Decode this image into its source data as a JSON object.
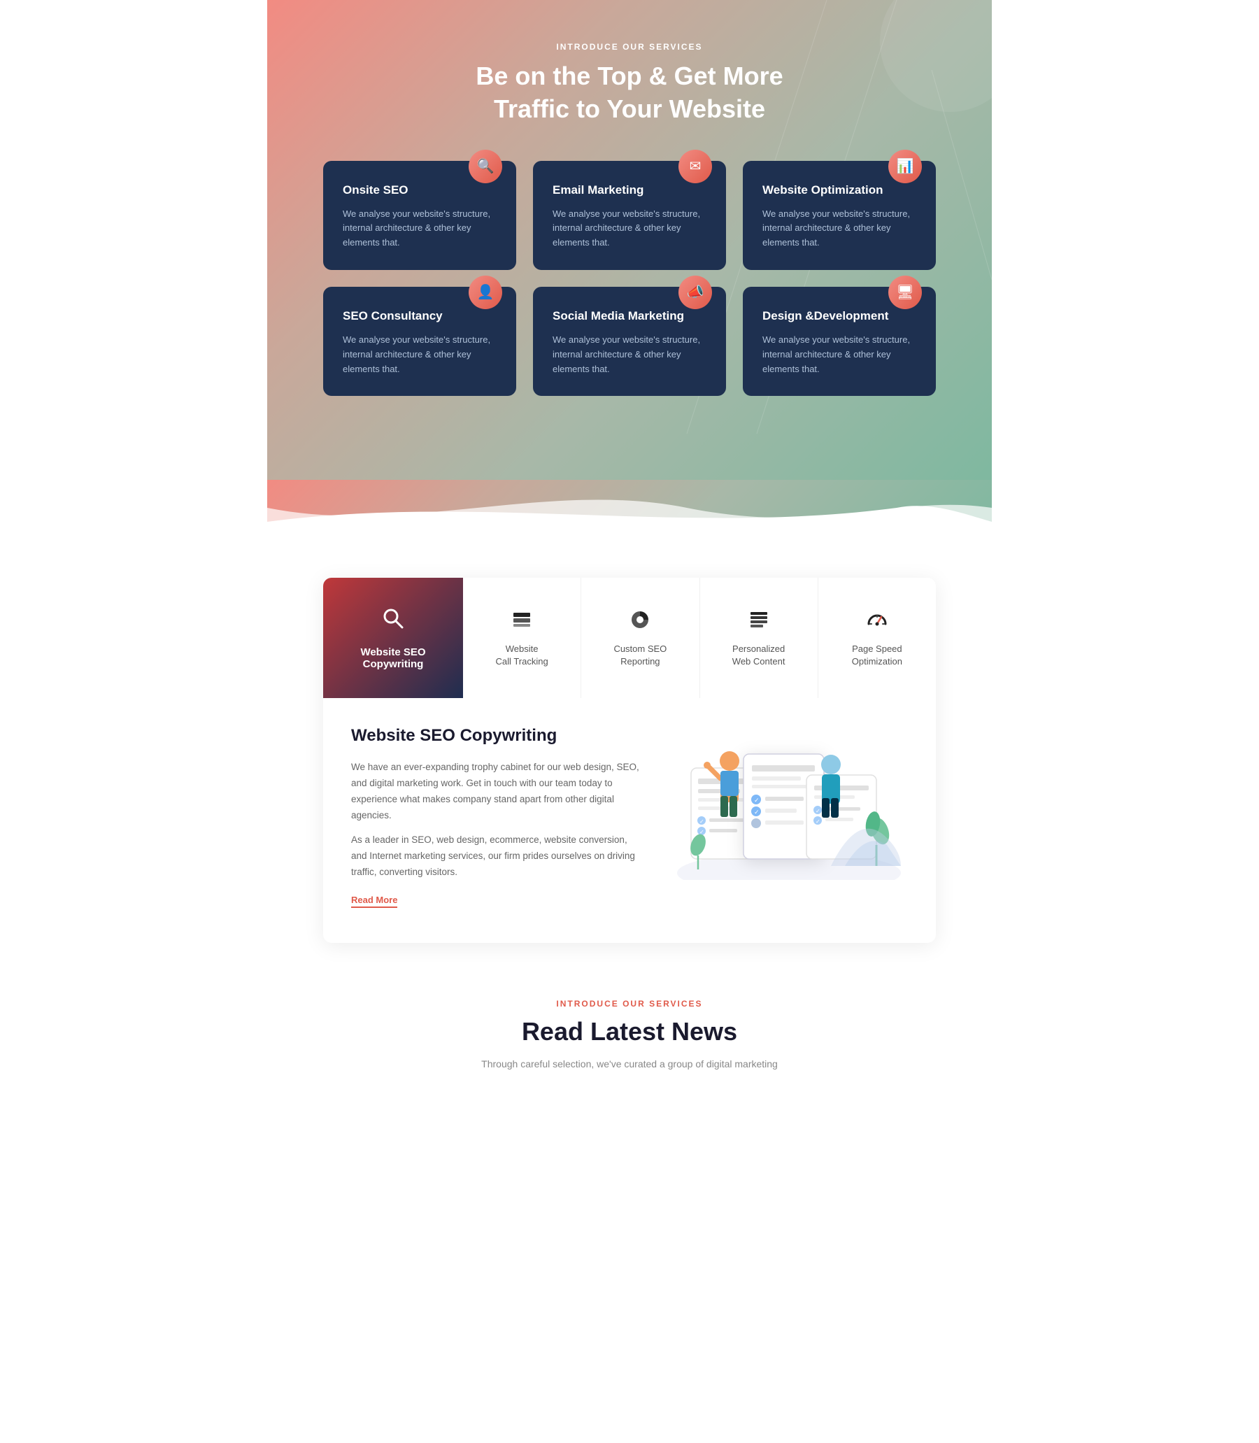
{
  "services_section": {
    "intro_label": "INTRODUCE OUR SERVICES",
    "title_line1": "Be on the Top & Get More",
    "title_line2": "Traffic to Your Website",
    "cards": [
      {
        "id": "onsite-seo",
        "title": "Onsite SEO",
        "desc": "We analyse your website's structure, internal architecture & other key elements that.",
        "icon": "🔍"
      },
      {
        "id": "email-marketing",
        "title": "Email Marketing",
        "desc": "We analyse your website's structure, internal architecture & other key elements that.",
        "icon": "✉"
      },
      {
        "id": "website-optimization",
        "title": "Website Optimization",
        "desc": "We analyse your website's structure, internal architecture & other key elements that.",
        "icon": "📊"
      },
      {
        "id": "seo-consultancy",
        "title": "SEO Consultancy",
        "desc": "We analyse your website's structure, internal architecture & other key elements that.",
        "icon": "👤"
      },
      {
        "id": "social-media-marketing",
        "title": "Social Media Marketing",
        "desc": "We analyse your website's structure, internal architecture & other key elements that.",
        "icon": "📣"
      },
      {
        "id": "design-development",
        "title": "Design &Development",
        "desc": "We analyse your website's structure, internal architecture & other key elements that.",
        "icon": "🖥"
      }
    ]
  },
  "tabs_section": {
    "tabs": [
      {
        "id": "website-seo-copywriting",
        "label": "Website SEO\nCopywriting",
        "icon": "search",
        "active": true
      },
      {
        "id": "website-call-tracking",
        "label": "Website\nCall Tracking",
        "icon": "layers",
        "active": false
      },
      {
        "id": "custom-seo-reporting",
        "label": "Custom SEO\nReporting",
        "icon": "pie",
        "active": false
      },
      {
        "id": "personalized-web-content",
        "label": "Personalized\nWeb Content",
        "icon": "list",
        "active": false
      },
      {
        "id": "page-speed-optimization",
        "label": "Page Speed\nOptimization",
        "icon": "speedometer",
        "active": false
      }
    ],
    "active_content": {
      "title": "Website SEO Copywriting",
      "desc1": "We have an ever-expanding trophy cabinet for our web design, SEO, and digital marketing work. Get in touch with our team today to experience what makes company stand apart from other digital agencies.",
      "desc2": "As a leader in SEO, web design, ecommerce, website conversion, and Internet marketing services, our firm prides ourselves on driving traffic, converting visitors.",
      "read_more_label": "Read More"
    }
  },
  "news_section": {
    "intro_label": "INTRODUCE OUR SERVICES",
    "title": "Read Latest News",
    "subtitle": "Through careful selection, we've curated a group of digital marketing"
  }
}
